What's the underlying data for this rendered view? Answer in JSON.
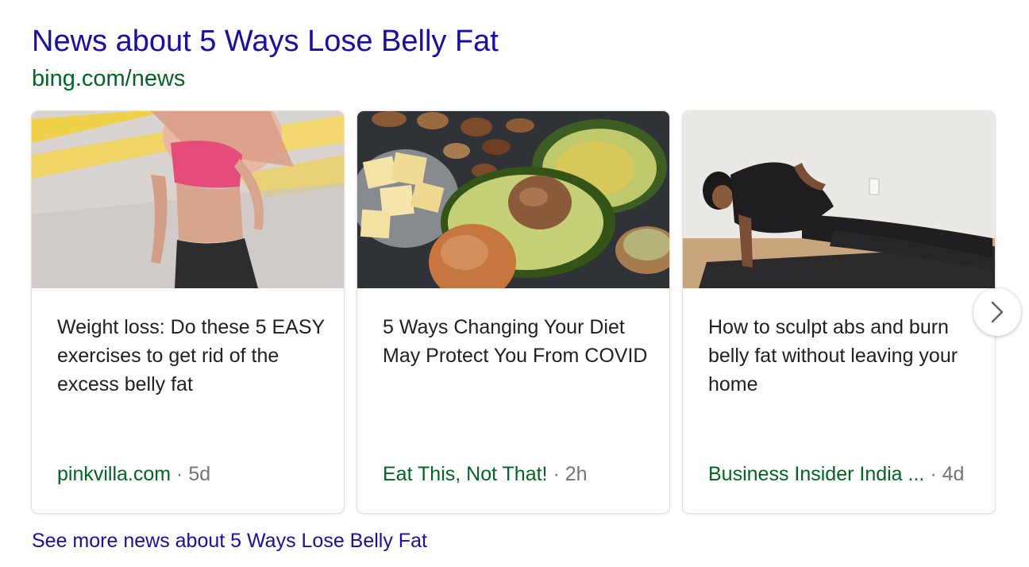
{
  "header": {
    "title": "News about 5 Ways Lose Belly Fat",
    "source": "bing.com/news"
  },
  "cards": [
    {
      "headline": "Weight loss: Do these 5 EASY exercises to get rid of the excess belly fat",
      "publisher": "pinkvilla.com",
      "separator": " · ",
      "age": "5d",
      "image": "woman-athletic-running-photo"
    },
    {
      "headline": "5 Ways Changing Your Diet May Protect You From COVID",
      "publisher": "Eat This, Not That!",
      "separator": " · ",
      "age": "2h",
      "image": "avocado-nuts-butter-photo"
    },
    {
      "headline": "How to sculpt abs and burn belly fat without leaving your home",
      "publisher": "Business Insider India ...",
      "separator": " · ",
      "age": "4d",
      "image": "man-side-plank-photo"
    }
  ],
  "carousel": {
    "next_icon": "chevron-right-icon"
  },
  "footer": {
    "see_more": "See more news about 5 Ways Lose Belly Fat"
  },
  "colors": {
    "link_blue": "#1a0dab",
    "url_green": "#006621",
    "text_dark": "#202124",
    "meta_gray": "#70757a"
  }
}
